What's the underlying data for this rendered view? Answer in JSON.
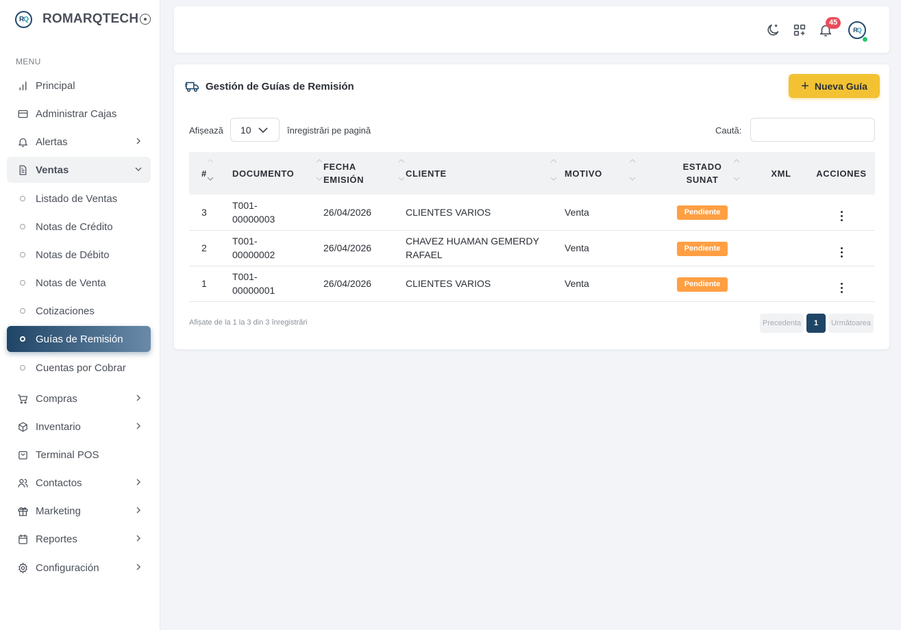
{
  "brand": {
    "logo_text": "RQ",
    "name": "ROMARQTECH"
  },
  "sidebar": {
    "menu_heading": "MENU",
    "items": [
      {
        "label": "Principal",
        "icon": "bar-chart-icon"
      },
      {
        "label": "Administrar Cajas",
        "icon": "card-icon"
      },
      {
        "label": "Alertas",
        "icon": "bell-icon",
        "has_children": true
      },
      {
        "label": "Ventas",
        "icon": "document-icon",
        "expanded": true,
        "children": [
          {
            "label": "Listado de Ventas"
          },
          {
            "label": "Notas de Crédito"
          },
          {
            "label": "Notas de Débito"
          },
          {
            "label": "Notas de Venta"
          },
          {
            "label": "Cotizaciones"
          },
          {
            "label": "Guías de Remisión",
            "active": true
          },
          {
            "label": "Cuentas por Cobrar"
          }
        ]
      },
      {
        "label": "Compras",
        "icon": "cart-icon",
        "has_children": true
      },
      {
        "label": "Inventario",
        "icon": "box-icon",
        "has_children": true
      },
      {
        "label": "Terminal POS",
        "icon": "bag-icon"
      },
      {
        "label": "Contactos",
        "icon": "users-icon",
        "has_children": true
      },
      {
        "label": "Marketing",
        "icon": "gift-icon",
        "has_children": true
      },
      {
        "label": "Reportes",
        "icon": "calendar-icon",
        "has_children": true
      },
      {
        "label": "Configuración",
        "icon": "gear-icon",
        "has_children": true
      }
    ]
  },
  "header": {
    "notifications_count": "45",
    "avatar_text": "RQ",
    "status_color": "#28c76f"
  },
  "page": {
    "title": "Gestión de Guías de Remisión",
    "new_button": "Nueva Guía",
    "length_label": "Afișează",
    "length_value": "10",
    "length_suffix": "înregistrări pe pagină",
    "search_label": "Caută:",
    "search_value": "",
    "columns": [
      "#",
      "DOCUMENTO",
      "FECHA EMISIÓN",
      "CLIENTE",
      "MOTIVO",
      "ESTADO SUNAT",
      "XML",
      "ACCIONES"
    ],
    "column_lines": {
      "fecha": [
        "FECHA",
        "EMISIÓN"
      ],
      "estado": [
        "ESTADO",
        "SUNAT"
      ]
    },
    "rows": [
      {
        "num": "3",
        "doc": [
          "T001-",
          "00000003"
        ],
        "fecha": "26/04/2026",
        "cliente": [
          "CLIENTES VARIOS"
        ],
        "motivo": "Venta",
        "estado": "Pendiente"
      },
      {
        "num": "2",
        "doc": [
          "T001-",
          "00000002"
        ],
        "fecha": "26/04/2026",
        "cliente": [
          "CHAVEZ HUAMAN GEMERDY",
          "RAFAEL"
        ],
        "motivo": "Venta",
        "estado": "Pendiente"
      },
      {
        "num": "1",
        "doc": [
          "T001-",
          "00000001"
        ],
        "fecha": "26/04/2026",
        "cliente": [
          "CLIENTES VARIOS"
        ],
        "motivo": "Venta",
        "estado": "Pendiente"
      }
    ],
    "info": "Afișate de la 1 la 3 din 3 înregistrări",
    "pager": {
      "prev": "Precedenta",
      "current": "1",
      "next": "Următoarea"
    }
  },
  "colors": {
    "accent_dark": "#1f4566",
    "button_yellow": "#f2c233",
    "badge_orange": "#ff9f43",
    "notify_red": "#ea4c5a"
  }
}
